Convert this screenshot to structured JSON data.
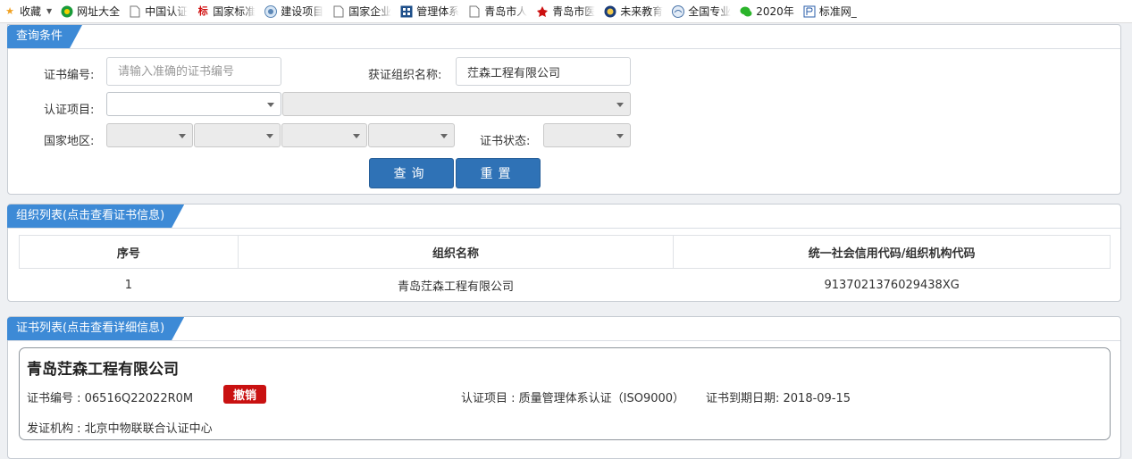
{
  "bookmarks": [
    {
      "label": "收藏",
      "icon": "star-icon"
    },
    {
      "label": "网址大全",
      "icon": "globe-green-icon"
    },
    {
      "label": "中国认证",
      "icon": "page-icon"
    },
    {
      "label": "国家标准",
      "icon": "biao-icon"
    },
    {
      "label": "建设项目",
      "icon": "emblem-icon"
    },
    {
      "label": "国家企业",
      "icon": "page-icon"
    },
    {
      "label": "管理体系",
      "icon": "grid-icon"
    },
    {
      "label": "青岛市人",
      "icon": "page-icon"
    },
    {
      "label": "青岛市医",
      "icon": "redleaf-icon"
    },
    {
      "label": "未来教育",
      "icon": "badge-icon"
    },
    {
      "label": "全国专业",
      "icon": "emblem-icon"
    },
    {
      "label": "2020年",
      "icon": "wechat-icon"
    },
    {
      "label": "标准网_",
      "icon": "book-icon"
    }
  ],
  "query": {
    "tag": "查询条件",
    "cert_no_label": "证书编号:",
    "cert_no_placeholder": "请输入准确的证书编号",
    "org_name_label": "获证组织名称:",
    "org_name_value": "茳森工程有限公司",
    "project_label": "认证项目:",
    "region_label": "国家地区:",
    "status_label": "证书状态:",
    "search_btn": "查询",
    "reset_btn": "重置"
  },
  "org_list": {
    "tag": "组织列表(点击查看证书信息)",
    "headers": [
      "序号",
      "组织名称",
      "统一社会信用代码/组织机构代码"
    ],
    "rows": [
      {
        "no": "1",
        "name": "青岛茳森工程有限公司",
        "code": "9137021376029438XG"
      }
    ]
  },
  "cert_list": {
    "tag": "证书列表(点击查看详细信息)",
    "company": "青岛茳森工程有限公司",
    "cert_no": "证书编号 : 06516Q22022R0M",
    "status_badge": "撤销",
    "status_color": "#c91111",
    "project": "认证项目 : 质量管理体系认证（ISO9000）",
    "expiry": "证书到期日期: 2018-09-15",
    "issuer": "发证机构 : 北京中物联联合认证中心"
  },
  "colors": {
    "accent": "#3d8ad6",
    "button": "#2f72b6"
  }
}
